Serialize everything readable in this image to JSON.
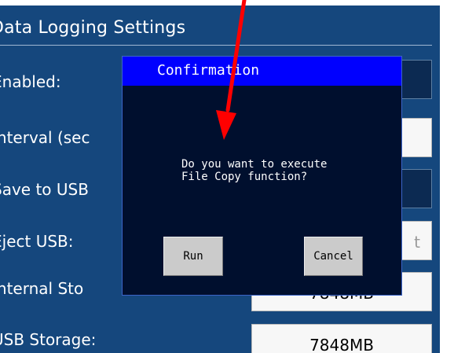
{
  "panel": {
    "title": "Data Logging Settings",
    "rows": [
      {
        "label": "Enabled:",
        "value": ""
      },
      {
        "label": "Interval (sec",
        "value": ""
      },
      {
        "label": "Save to USB",
        "value": ""
      },
      {
        "label": "Eject USB:",
        "value": "t"
      },
      {
        "label": "Internal Sto",
        "value": "7848MB"
      },
      {
        "label": "USB Storage:",
        "value": "7848MB"
      }
    ]
  },
  "dialog": {
    "title": "Confirmation",
    "message": "Do you want to execute\nFile Copy function?",
    "run_label": "Run",
    "cancel_label": "Cancel"
  },
  "colors": {
    "screen_background": "#15477d",
    "dialog_titlebar": "#0000ff",
    "dialog_body": "#000f2e",
    "annotation_arrow": "#ff0000"
  },
  "annotation": {
    "type": "arrow",
    "color": "#ff0000"
  }
}
